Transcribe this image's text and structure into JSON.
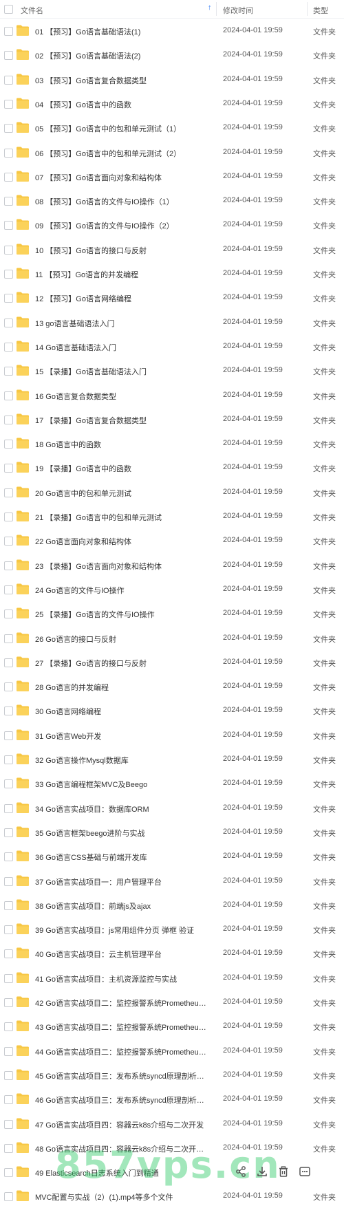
{
  "header": {
    "col_name": "文件名",
    "sort_icon": "arrow-up-icon",
    "col_time": "修改时间",
    "col_type": "类型"
  },
  "folder_color": "#f7c744",
  "accent": "#3b82f6",
  "watermark": "857vps.cn",
  "row_actions": [
    "share-icon",
    "download-icon",
    "delete-icon",
    "more-icon"
  ],
  "rows": [
    {
      "name": "01 【预习】Go语言基础语法(1)",
      "time": "2024-04-01 19:59",
      "type": "文件夹"
    },
    {
      "name": "02 【预习】Go语言基础语法(2)",
      "time": "2024-04-01 19:59",
      "type": "文件夹"
    },
    {
      "name": "03 【预习】Go语言复合数据类型",
      "time": "2024-04-01 19:59",
      "type": "文件夹"
    },
    {
      "name": "04 【预习】Go语言中的函数",
      "time": "2024-04-01 19:59",
      "type": "文件夹"
    },
    {
      "name": "05 【预习】Go语言中的包和单元测试（1）",
      "time": "2024-04-01 19:59",
      "type": "文件夹"
    },
    {
      "name": "06 【预习】Go语言中的包和单元测试（2）",
      "time": "2024-04-01 19:59",
      "type": "文件夹"
    },
    {
      "name": "07 【预习】Go语言面向对象和结构体",
      "time": "2024-04-01 19:59",
      "type": "文件夹"
    },
    {
      "name": "08 【预习】Go语言的文件与IO操作（1）",
      "time": "2024-04-01 19:59",
      "type": "文件夹"
    },
    {
      "name": "09 【预习】Go语言的文件与IO操作（2）",
      "time": "2024-04-01 19:59",
      "type": "文件夹"
    },
    {
      "name": "10 【预习】Go语言的接口与反射",
      "time": "2024-04-01 19:59",
      "type": "文件夹"
    },
    {
      "name": "11 【预习】Go语言的并发编程",
      "time": "2024-04-01 19:59",
      "type": "文件夹"
    },
    {
      "name": "12 【预习】Go语言网络编程",
      "time": "2024-04-01 19:59",
      "type": "文件夹"
    },
    {
      "name": "13 go语言基础语法入门",
      "time": "2024-04-01 19:59",
      "type": "文件夹"
    },
    {
      "name": "14 Go语言基础语法入门",
      "time": "2024-04-01 19:59",
      "type": "文件夹"
    },
    {
      "name": "15 【录播】Go语言基础语法入门",
      "time": "2024-04-01 19:59",
      "type": "文件夹"
    },
    {
      "name": "16 Go语言复合数据类型",
      "time": "2024-04-01 19:59",
      "type": "文件夹"
    },
    {
      "name": "17 【录播】Go语言复合数据类型",
      "time": "2024-04-01 19:59",
      "type": "文件夹"
    },
    {
      "name": "18 Go语言中的函数",
      "time": "2024-04-01 19:59",
      "type": "文件夹"
    },
    {
      "name": "19 【录播】Go语言中的函数",
      "time": "2024-04-01 19:59",
      "type": "文件夹"
    },
    {
      "name": "20 Go语言中的包和单元测试",
      "time": "2024-04-01 19:59",
      "type": "文件夹"
    },
    {
      "name": "21 【录播】Go语言中的包和单元测试",
      "time": "2024-04-01 19:59",
      "type": "文件夹"
    },
    {
      "name": "22 Go语言面向对象和结构体",
      "time": "2024-04-01 19:59",
      "type": "文件夹"
    },
    {
      "name": "23 【录播】Go语言面向对象和结构体",
      "time": "2024-04-01 19:59",
      "type": "文件夹"
    },
    {
      "name": "24 Go语言的文件与IO操作",
      "time": "2024-04-01 19:59",
      "type": "文件夹"
    },
    {
      "name": "25 【录播】Go语言的文件与IO操作",
      "time": "2024-04-01 19:59",
      "type": "文件夹"
    },
    {
      "name": "26 Go语言的接口与反射",
      "time": "2024-04-01 19:59",
      "type": "文件夹"
    },
    {
      "name": "27 【录播】Go语言的接口与反射",
      "time": "2024-04-01 19:59",
      "type": "文件夹"
    },
    {
      "name": "28 Go语言的并发编程",
      "time": "2024-04-01 19:59",
      "type": "文件夹"
    },
    {
      "name": "30 Go语言网络编程",
      "time": "2024-04-01 19:59",
      "type": "文件夹"
    },
    {
      "name": "31 Go语言Web开发",
      "time": "2024-04-01 19:59",
      "type": "文件夹"
    },
    {
      "name": "32 Go语言操作Mysql数据库",
      "time": "2024-04-01 19:59",
      "type": "文件夹"
    },
    {
      "name": "33 Go语言编程框架MVC及Beego",
      "time": "2024-04-01 19:59",
      "type": "文件夹"
    },
    {
      "name": "34 Go语言实战项目：数据库ORM",
      "time": "2024-04-01 19:59",
      "type": "文件夹"
    },
    {
      "name": "35 Go语言框架beego进阶与实战",
      "time": "2024-04-01 19:59",
      "type": "文件夹"
    },
    {
      "name": "36 Go语言CSS基础与前端开发库",
      "time": "2024-04-01 19:59",
      "type": "文件夹"
    },
    {
      "name": "37 Go语言实战项目一：用户管理平台",
      "time": "2024-04-01 19:59",
      "type": "文件夹"
    },
    {
      "name": "38 Go语言实战项目：前端js及ajax",
      "time": "2024-04-01 19:59",
      "type": "文件夹"
    },
    {
      "name": "39 Go语言实战项目：js常用组件分页  弹框  验证",
      "time": "2024-04-01 19:59",
      "type": "文件夹"
    },
    {
      "name": "40 Go语言实战项目：云主机管理平台",
      "time": "2024-04-01 19:59",
      "type": "文件夹"
    },
    {
      "name": "41 Go语言实战项目：主机资源监控与实战",
      "time": "2024-04-01 19:59",
      "type": "文件夹"
    },
    {
      "name": "42 Go语言实战项目二：监控报警系统Prometheus...",
      "time": "2024-04-01 19:59",
      "type": "文件夹"
    },
    {
      "name": "43 Go语言实战项目二：监控报警系统Prometheus...",
      "time": "2024-04-01 19:59",
      "type": "文件夹"
    },
    {
      "name": "44 Go语言实战项目二：监控报警系统Prometheus...",
      "time": "2024-04-01 19:59",
      "type": "文件夹"
    },
    {
      "name": "45 Go语言实战项目三：发布系统syncd原理剖析与...",
      "time": "2024-04-01 19:59",
      "type": "文件夹"
    },
    {
      "name": "46 Go语言实战项目三：发布系统syncd原理剖析与...",
      "time": "2024-04-01 19:59",
      "type": "文件夹"
    },
    {
      "name": "47 Go语言实战项目四：容器云k8s介绍与二次开发",
      "time": "2024-04-01 19:59",
      "type": "文件夹"
    },
    {
      "name": "48 Go语言实战项目四：容器云k8s介绍与二次开发（...",
      "time": "2024-04-01 19:59",
      "type": "文件夹"
    },
    {
      "name": "49 Elasticsearch日志系统入门到精通",
      "time": "",
      "type": ""
    },
    {
      "name": "MVC配置与实战（2）(1).mp4等多个文件",
      "time": "2024-04-01 19:59",
      "type": "文件夹"
    }
  ]
}
